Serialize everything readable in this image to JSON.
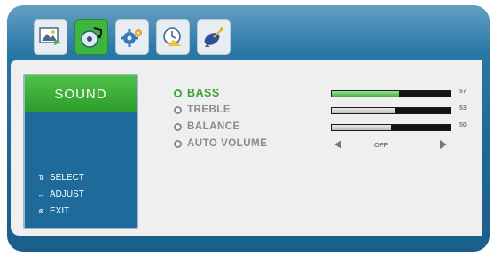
{
  "menu": {
    "tabs": [
      {
        "icon": "picture-icon",
        "active": false
      },
      {
        "icon": "sound-icon",
        "active": true
      },
      {
        "icon": "setup-gear-icon",
        "active": false
      },
      {
        "icon": "time-clock-icon",
        "active": false
      },
      {
        "icon": "channel-satellite-icon",
        "active": false
      }
    ],
    "section_title": "SOUND",
    "help": [
      {
        "icon": "updown-arrows-icon",
        "text": "SELECT"
      },
      {
        "icon": "leftright-arrows-icon",
        "text": "ADJUST"
      },
      {
        "icon": "exit-icon",
        "text": "EXIT"
      }
    ],
    "items": [
      {
        "label": "BASS",
        "value": "57",
        "level": 57,
        "active": true
      },
      {
        "label": "TREBLE",
        "value": "53",
        "level": 53
      },
      {
        "label": "BALANCE",
        "value": "50",
        "level": 50
      },
      {
        "label": "AUTO VOLUME",
        "option": "OFF"
      }
    ]
  },
  "colors": {
    "frame": "#1d6797",
    "accent": "#3db73b",
    "panel": "#efefef"
  }
}
